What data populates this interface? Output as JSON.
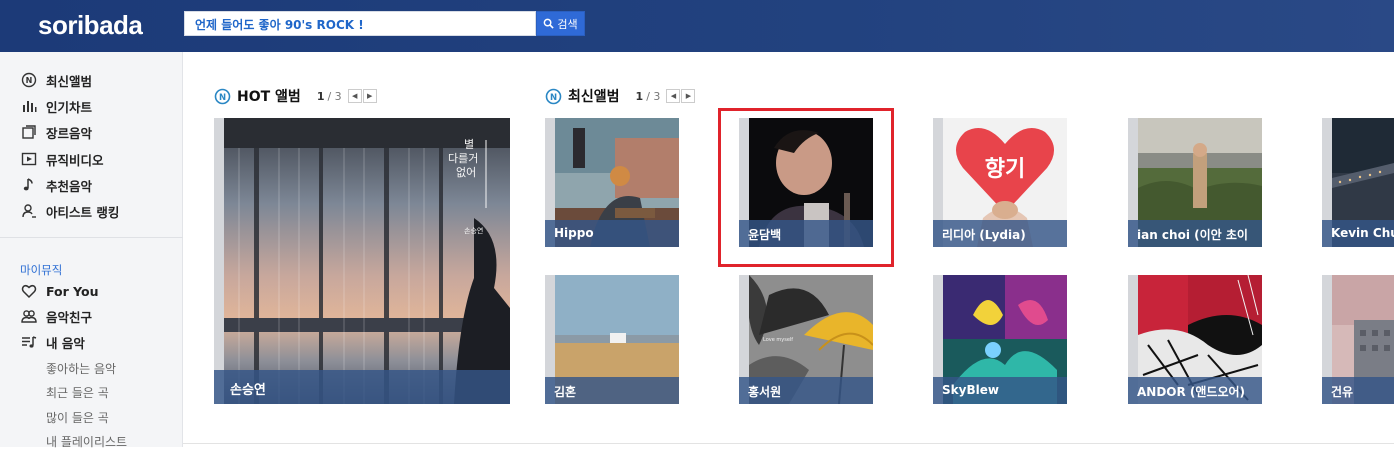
{
  "header": {
    "logo": "soribada",
    "search_value": "언제 들어도 좋아 90's ROCK !",
    "search_button": "검색"
  },
  "sidebar": {
    "items": [
      {
        "label": "최신앨범",
        "icon": "new-album-icon"
      },
      {
        "label": "인기차트",
        "icon": "chart-icon"
      },
      {
        "label": "장르음악",
        "icon": "genre-icon"
      },
      {
        "label": "뮤직비디오",
        "icon": "video-icon"
      },
      {
        "label": "추천음악",
        "icon": "music-note-icon"
      },
      {
        "label": "아티스트 랭킹",
        "icon": "artist-icon"
      }
    ],
    "my_music_title": "마이뮤직",
    "my_items": [
      {
        "label": "For You",
        "icon": "heart-icon"
      },
      {
        "label": "음악친구",
        "icon": "friends-icon"
      },
      {
        "label": "내 음악",
        "icon": "playlist-icon"
      }
    ],
    "sub_items": [
      "좋아하는 음악",
      "최근 들은 곡",
      "많이 들은 곡",
      "내 플레이리스트"
    ]
  },
  "hot": {
    "title": "HOT 앨범",
    "page_current": "1",
    "page_total": "/ 3",
    "album": {
      "artist": "손승연",
      "cover_text_1": "별",
      "cover_text_2": "다를거",
      "cover_text_3": "없어",
      "cover_signature": "손승연"
    }
  },
  "latest": {
    "title": "최신앨범",
    "page_current": "1",
    "page_total": "/ 3",
    "row1": [
      "Hippo",
      "윤담백",
      "리디아 (Lydia)",
      "ian choi (이안 초이",
      "Kevin Chu"
    ],
    "row2": [
      "김혼",
      "홍서원",
      "SkyBlew",
      "ANDOR (앤드오어)",
      "건유"
    ],
    "cover_texts": {
      "heart": "향기",
      "umbrella": "Love myself"
    }
  },
  "colors": {
    "header_bg": "#1c3a78",
    "accent": "#2f6ad7",
    "caption_bg": "#345688",
    "highlight": "#e0232b"
  }
}
